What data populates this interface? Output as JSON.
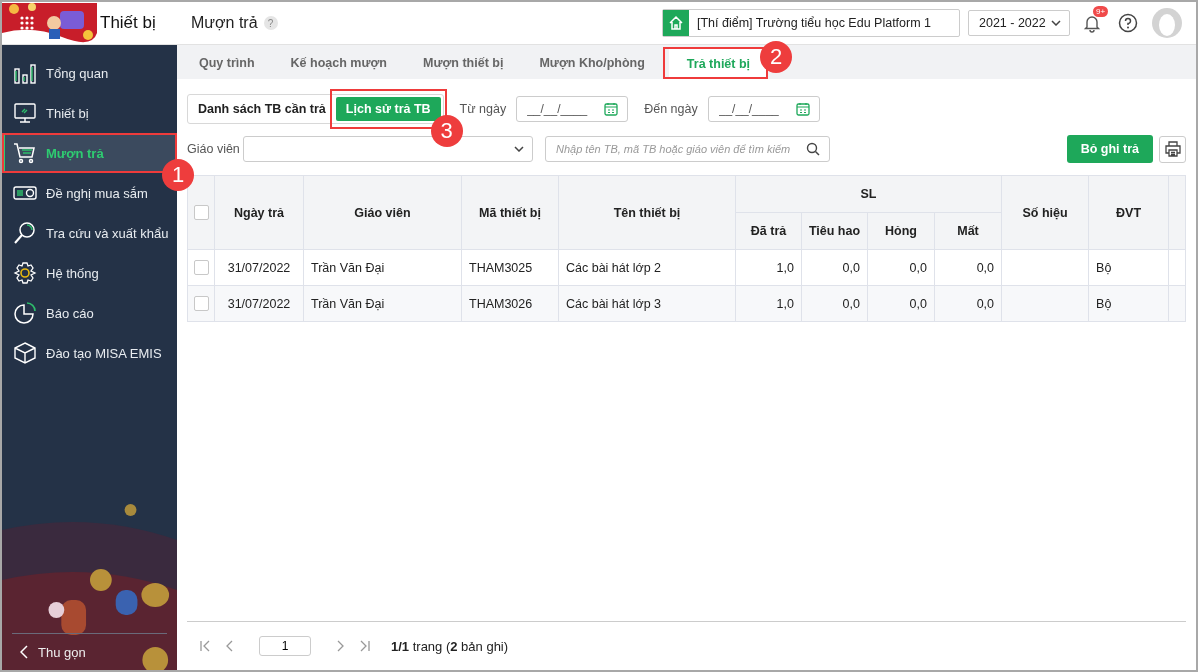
{
  "app": {
    "module_title": "Thiết bị",
    "page_title": "Mượn trả",
    "help_badge": "?"
  },
  "header": {
    "school": "[Thí điểm] Trường tiểu học Edu Platform 1",
    "year": "2021 - 2022",
    "notification_badge": "9+"
  },
  "sidebar": {
    "items": [
      {
        "label": "Tổng quan",
        "selected": false
      },
      {
        "label": "Thiết bị",
        "selected": false
      },
      {
        "label": "Mượn trả",
        "selected": true,
        "callout": "1"
      },
      {
        "label": "Đề nghị mua sắm",
        "selected": false
      },
      {
        "label": "Tra cứu và xuất khẩu",
        "selected": false
      },
      {
        "label": "Hệ thống",
        "selected": false
      },
      {
        "label": "Báo cáo",
        "selected": false
      },
      {
        "label": "Đào tạo MISA EMIS",
        "selected": false
      }
    ],
    "collapse": "Thu gọn"
  },
  "tabs": [
    {
      "label": "Quy trình",
      "selected": false
    },
    {
      "label": "Kế hoạch mượn",
      "selected": false
    },
    {
      "label": "Mượn thiết bị",
      "selected": false
    },
    {
      "label": "Mượn Kho/phòng",
      "selected": false
    },
    {
      "label": "Trả thiết bị",
      "selected": true,
      "callout": "2"
    }
  ],
  "subtabs": [
    {
      "label": "Danh sách TB cần trả",
      "selected": false
    },
    {
      "label": "Lịch sử trả TB",
      "selected": true,
      "callout": "3"
    }
  ],
  "filters": {
    "from_label": "Từ ngày",
    "from_placeholder": "__/__/____",
    "to_label": "Đến ngày",
    "to_placeholder": "__/__/____",
    "teacher_label": "Giáo viên",
    "search_placeholder": "Nhập tên TB, mã TB hoặc giáo viên để tìm kiếm"
  },
  "actions": {
    "unrecord": "Bỏ ghi trả"
  },
  "table": {
    "all_checked": false,
    "columns": [
      {
        "label": "Ngày trả"
      },
      {
        "label": "Giáo viên"
      },
      {
        "label": "Mã thiết bị"
      },
      {
        "label": "Tên thiết bị"
      },
      {
        "label": "SL",
        "colspan": 4,
        "children": [
          {
            "label": "Đã trả"
          },
          {
            "label": "Tiêu hao"
          },
          {
            "label": "Hỏng"
          },
          {
            "label": "Mất"
          }
        ]
      },
      {
        "label": "Số hiệu"
      },
      {
        "label": "ĐVT"
      }
    ],
    "rows": [
      {
        "checked": false,
        "cells": [
          "31/07/2022",
          "Trần Văn Đại",
          "THAM3025",
          "Các bài hát lớp 2",
          "1,0",
          "0,0",
          "0,0",
          "0,0",
          null,
          "Bộ"
        ]
      },
      {
        "checked": false,
        "cells": [
          "31/07/2022",
          "Trần Văn Đại",
          "THAM3026",
          "Các bài hát lớp 3",
          "1,0",
          "0,0",
          "0,0",
          "0,0",
          null,
          "Bộ"
        ]
      }
    ]
  },
  "pagination": {
    "page": "1",
    "summary": "**1/1** trang (**2** bản ghi)"
  }
}
